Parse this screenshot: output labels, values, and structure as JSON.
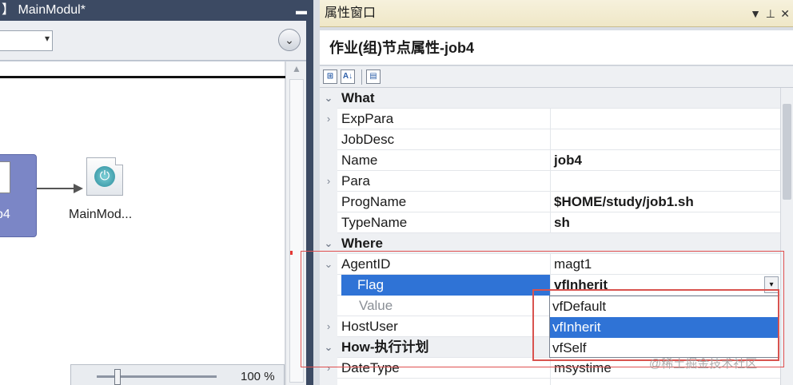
{
  "designer": {
    "title": "】 MainModul*",
    "pin_glyph": "▬",
    "collapse_glyph": "⌄",
    "job_node_label": "b4",
    "module_label": "MainMod...",
    "zoom_label": "100 %",
    "scroll_up_glyph": "▲"
  },
  "property_window": {
    "title": "属性窗口",
    "title_controls": [
      "▼",
      "⊥",
      "✕"
    ],
    "header": "作业(组)节点属性-job4",
    "toolbar": {
      "categorized_icon": "⊞",
      "alphabetical_icon": "A↓",
      "pages_icon": "▤"
    },
    "rows": [
      {
        "type": "category",
        "expand": "⌄",
        "name": "What"
      },
      {
        "type": "prop",
        "expand": "›",
        "name": "ExpPara",
        "value": ""
      },
      {
        "type": "prop",
        "expand": "",
        "name": "JobDesc",
        "value": ""
      },
      {
        "type": "prop",
        "expand": "",
        "name": "Name",
        "value": "job4",
        "bold": true
      },
      {
        "type": "prop",
        "expand": "›",
        "name": "Para",
        "value": ""
      },
      {
        "type": "prop",
        "expand": "",
        "name": "ProgName",
        "value": "$HOME/study/job1.sh",
        "bold": true
      },
      {
        "type": "prop",
        "expand": "",
        "name": "TypeName",
        "value": "sh",
        "bold": true
      },
      {
        "type": "category",
        "expand": "⌄",
        "name": "Where"
      },
      {
        "type": "prop",
        "expand": "⌄",
        "name": "AgentID",
        "value": "magt1"
      },
      {
        "type": "selected",
        "expand": "",
        "name": "Flag",
        "value": "vfInherit",
        "bold": true
      },
      {
        "type": "dim",
        "expand": "",
        "name": "Value",
        "value": ""
      },
      {
        "type": "prop",
        "expand": "›",
        "name": "HostUser",
        "value": ""
      },
      {
        "type": "category",
        "expand": "⌄",
        "name": "How-执行计划"
      },
      {
        "type": "prop",
        "expand": "›",
        "name": "DateType",
        "value": "msystime"
      },
      {
        "type": "prop",
        "expand": "",
        "name": "",
        "value": ""
      }
    ],
    "dropdown_arrow": "▾",
    "dropdown_options": [
      {
        "label": "vfDefault",
        "active": false
      },
      {
        "label": "vfInherit",
        "active": true
      },
      {
        "label": "vfSelf",
        "active": false
      }
    ]
  },
  "watermark": "@稀土掘金技术社区",
  "colors": {
    "selection": "#2f73d6",
    "highlight_border": "#d9534f",
    "node_fill": "#7b86c6"
  }
}
